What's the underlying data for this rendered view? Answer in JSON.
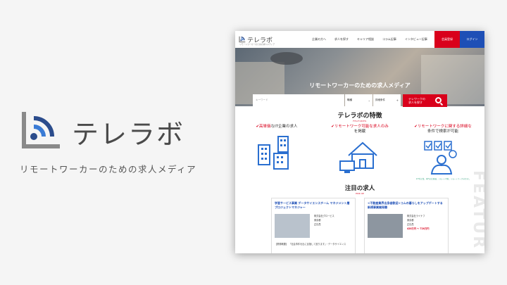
{
  "brand": {
    "title": "テレラボ",
    "tagline": "リモートワーカーのための求人メディア",
    "colors": {
      "accent_blue": "#3a7bd5",
      "dark_blue": "#2b4c8c",
      "gray": "#8a8a8a"
    }
  },
  "site": {
    "logo_text": "テレラボ",
    "logo_sub": "リモートワーカーのための求人メディア",
    "nav": [
      "企業の方へ",
      "求人を探す",
      "キャリア相談",
      "コラム記事",
      "インタビュー記事"
    ],
    "register_label": "会員登録",
    "login_label": "ログイン",
    "colors": {
      "red": "#d9001b",
      "blue": "#1e4fb6"
    }
  },
  "hero": {
    "title": "リモートワーカーのための求人メディア",
    "keyword_placeholder": "キーワード",
    "occupation_label": "職種",
    "conditions_label": "詳細条件",
    "search_button_line1": "テレワークの",
    "search_button_line2": "求人を探す"
  },
  "features": {
    "title": "テレラボの特徴",
    "subtitle": "FEATURES",
    "items": [
      {
        "line1_red": "高単価",
        "line1_rest": "な",
        "line2": "IT企業の求人",
        "icon": "buildings-icon"
      },
      {
        "line1_red": "リモートワーク可能な求人のみ",
        "line1_rest": "",
        "line2": "を掲載",
        "icon": "house-computer-icon"
      },
      {
        "line1_red": "リモートワークに関する詳細な",
        "line1_rest": "",
        "line2": "条件で検索が可能",
        "icon": "person-checklist-icon"
      }
    ],
    "note": "※IT系企業、専門の比較軸、リモート可能、リモートワーク分けまし"
  },
  "pickup": {
    "title": "注目の求人",
    "subtitle": "PICK UP",
    "watermark": "FEATUR",
    "cards": [
      {
        "title": "学習サービス事業 データサイエンスチーム マネジメント層プロジェクトマネジャー",
        "company": "株式会社グロービス",
        "location": "東京都",
        "type": "正社員",
        "salary": "",
        "desc": "【業務概要】 「社会事件を出に目指して進ります」・データサイエンス"
      },
      {
        "title": "<不動産業界出身者歓迎>コムの暮らしをアップデートする新規事業開発職",
        "company": "株式会社ライナフ",
        "location": "東京都",
        "type": "正社員",
        "salary": "420万円 〜 720万円",
        "desc": ""
      }
    ]
  }
}
